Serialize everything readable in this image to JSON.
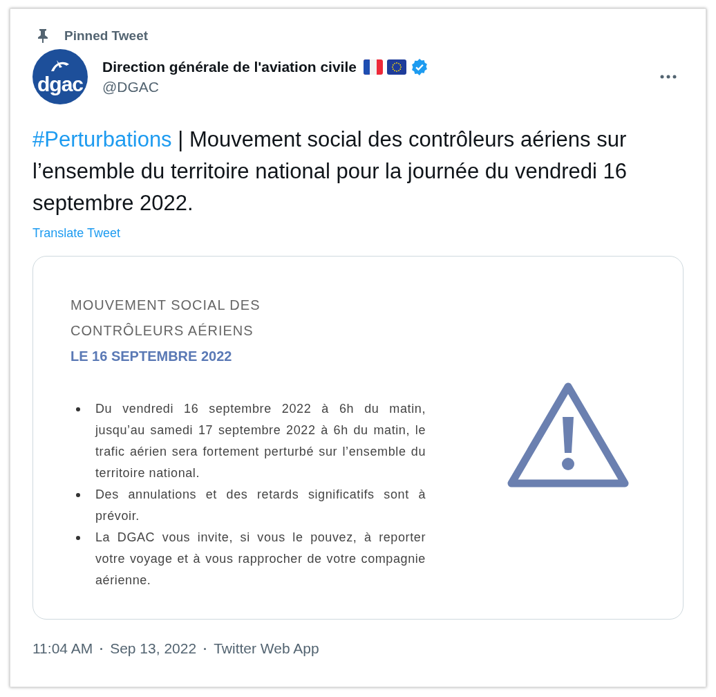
{
  "pinned_label": "Pinned Tweet",
  "author": {
    "avatar_text": "dgac",
    "name": "Direction générale de l'aviation civile",
    "handle": "@DGAC",
    "verified": true
  },
  "tweet": {
    "hashtag": "#Perturbations",
    "text": " | Mouvement social des contrôleurs aériens sur l’ensemble du territoire national pour la journée du vendredi 16 septembre 2022.",
    "translate": "Translate Tweet"
  },
  "media": {
    "heading_lines": [
      "MOUVEMENT SOCIAL DES",
      "CONTRÔLEURS AÉRIENS"
    ],
    "date_line": "LE 16 SEPTEMBRE 2022",
    "bullets": [
      "Du vendredi 16 septembre 2022 à 6h du matin, jusqu’au samedi 17 septembre 2022 à 6h du matin, le trafic aérien sera fortement perturbé sur l’ensemble du territoire national.",
      "Des annulations et des retards significatifs sont à prévoir.",
      "La DGAC vous invite, si vous le pouvez, à reporter votre voyage et à vous rapprocher de votre compagnie aérienne."
    ]
  },
  "footer": {
    "time": "11:04 AM",
    "date": "Sep 13, 2022",
    "source": "Twitter Web App"
  }
}
